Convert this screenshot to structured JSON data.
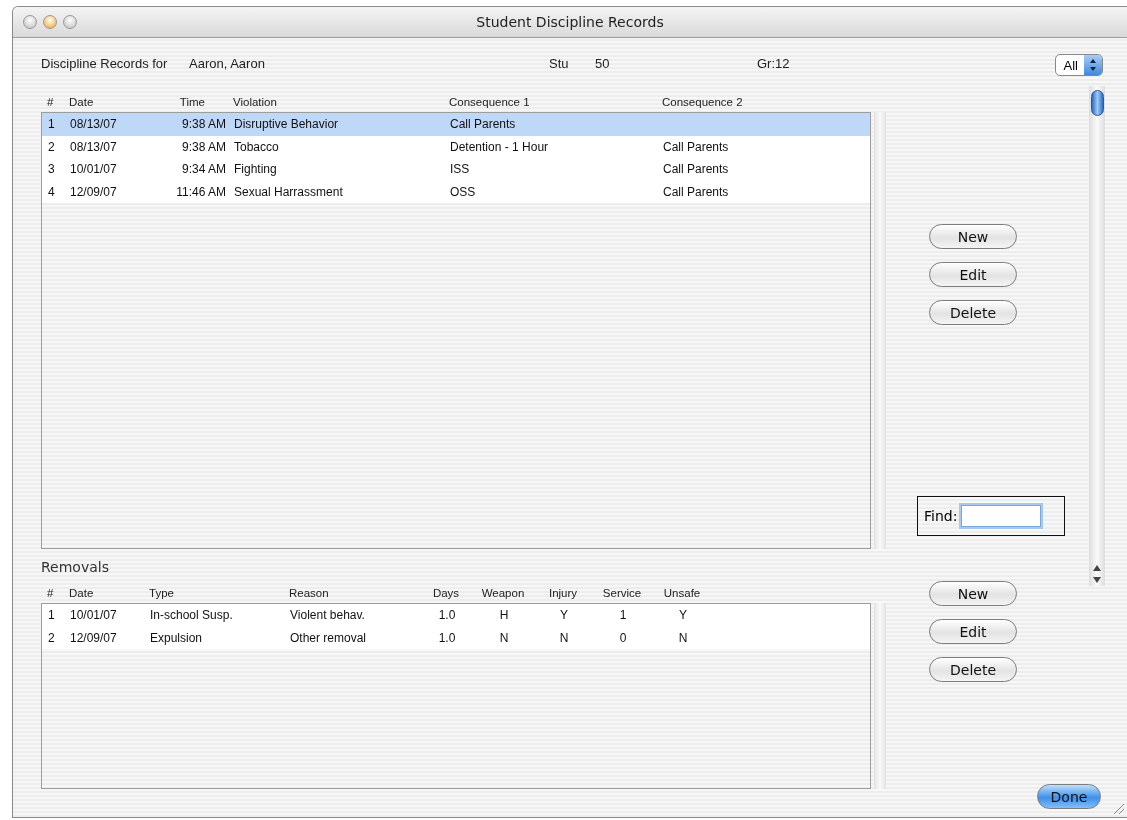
{
  "window": {
    "title": "Student Discipline Records"
  },
  "student": {
    "label": "Discipline Records for",
    "name": "Aaron, Aaron",
    "id_label": "Stu",
    "id": "50",
    "grade": "Gr:12"
  },
  "filter": {
    "value": "All"
  },
  "discipline": {
    "columns": [
      "#",
      "Date",
      "Time",
      "Violation",
      "Consequence 1",
      "Consequence 2"
    ],
    "rows": [
      {
        "cells": [
          "1",
          "08/13/07",
          "9:38 AM",
          "Disruptive Behavior",
          "Call Parents",
          ""
        ],
        "selected": true
      },
      {
        "cells": [
          "2",
          "08/13/07",
          "9:38 AM",
          "Tobacco",
          "Detention - 1 Hour",
          "Call Parents"
        ],
        "selected": false
      },
      {
        "cells": [
          "3",
          "10/01/07",
          "9:34 AM",
          "Fighting",
          "ISS",
          "Call Parents"
        ],
        "selected": false
      },
      {
        "cells": [
          "4",
          "12/09/07",
          "11:46 AM",
          "Sexual Harrassment",
          "OSS",
          "Call Parents"
        ],
        "selected": false
      }
    ],
    "buttons": [
      "New",
      "Edit",
      "Delete"
    ]
  },
  "find": {
    "label": "Find:"
  },
  "removals": {
    "title": "Removals",
    "columns": [
      "#",
      "Date",
      "Type",
      "Reason",
      "Days",
      "Weapon",
      "Injury",
      "Service",
      "Unsafe"
    ],
    "rows": [
      {
        "cells": [
          "1",
          "10/01/07",
          "In-school Susp.",
          "Violent behav.",
          "1.0",
          "H",
          "Y",
          "1",
          "Y"
        ],
        "selected": false
      },
      {
        "cells": [
          "2",
          "12/09/07",
          "Expulsion",
          "Other removal",
          "1.0",
          "N",
          "N",
          "0",
          "N"
        ],
        "selected": false
      }
    ],
    "buttons": [
      "New",
      "Edit",
      "Delete"
    ]
  },
  "done_button": "Done"
}
